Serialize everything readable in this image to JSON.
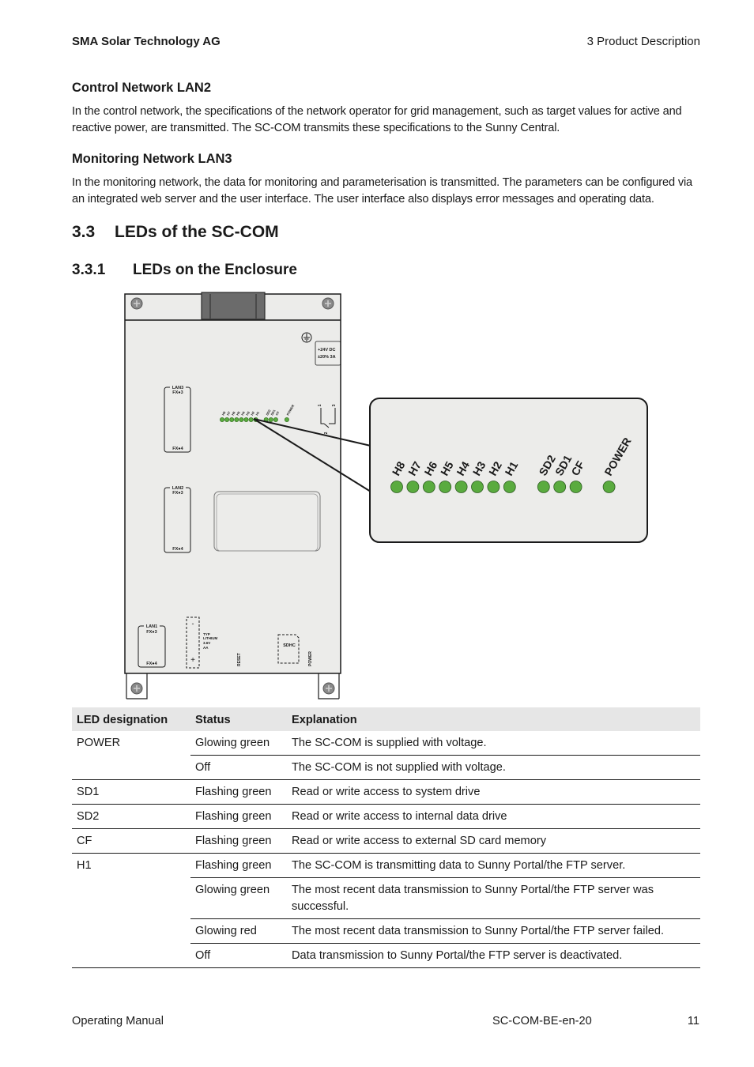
{
  "header": {
    "company": "SMA Solar Technology AG",
    "chapter": "3  Product Description"
  },
  "sections": {
    "control_network": {
      "title": "Control Network LAN2",
      "text": "In the control network, the specifications of the network operator for grid management, such as target values for active and reactive power, are transmitted. The SC-COM transmits these specifications to the Sunny Central."
    },
    "monitoring_network": {
      "title": "Monitoring Network LAN3",
      "text": "In the monitoring network, the data for monitoring and parameterisation is transmitted. The parameters can be configured via an integrated web server and the user interface. The user interface also displays error messages and operating data."
    },
    "leds_section": {
      "number": "3.3",
      "title": "LEDs of the SC-COM"
    },
    "leds_enclosure": {
      "number": "3.3.1",
      "title": "LEDs on the Enclosure"
    }
  },
  "figure": {
    "power_label_line1": "+24V DC",
    "power_label_line2": "±20% 3A",
    "lan3": {
      "title": "LAN3",
      "top": "FX●3",
      "bottom": "FX●4"
    },
    "lan2": {
      "title": "LAN2",
      "top": "FX●3",
      "bottom": "FX●4"
    },
    "lan1": {
      "title": "LAN1",
      "top": "FX●3",
      "bottom": "FX●4"
    },
    "relay_pins": [
      "1",
      "2",
      "3"
    ],
    "battery": {
      "minus": "-",
      "plus": "+",
      "spec": [
        "TYP",
        "LITHIUM",
        "3.6V",
        "AA"
      ]
    },
    "reset_label": "RESET",
    "sdhc_label": "SDHC",
    "power_button_label": "POWER",
    "led_color": "#5aab3f",
    "callout_leds": {
      "h_group": [
        "H8",
        "H7",
        "H6",
        "H5",
        "H4",
        "H3",
        "H2",
        "H1"
      ],
      "sd_group": [
        "SD2",
        "SD1",
        "CF"
      ],
      "power": "POWER"
    }
  },
  "table": {
    "headers": [
      "LED designation",
      "Status",
      "Explanation"
    ],
    "rows": [
      {
        "led": "POWER",
        "status": "Glowing green",
        "explanation": "The SC-COM is supplied with voltage."
      },
      {
        "led": "",
        "status": "Off",
        "explanation": "The SC-COM is not supplied with voltage."
      },
      {
        "led": "SD1",
        "status": "Flashing green",
        "explanation": "Read or write access to system drive"
      },
      {
        "led": "SD2",
        "status": "Flashing green",
        "explanation": "Read or write access to internal data drive"
      },
      {
        "led": "CF",
        "status": "Flashing green",
        "explanation": "Read or write access to external SD card memory"
      },
      {
        "led": "H1",
        "status": "Flashing green",
        "explanation": "The SC-COM is transmitting data to Sunny Portal/the FTP server."
      },
      {
        "led": "",
        "status": "Glowing green",
        "explanation": "The most recent data transmission to Sunny Portal/the FTP server was successful."
      },
      {
        "led": "",
        "status": "Glowing red",
        "explanation": "The most recent data transmission to Sunny Portal/the FTP server failed."
      },
      {
        "led": "",
        "status": "Off",
        "explanation": "Data transmission to Sunny Portal/the FTP server is deactivated."
      }
    ]
  },
  "footer": {
    "doc_type": "Operating Manual",
    "doc_code": "SC-COM-BE-en-20",
    "page": "11"
  }
}
